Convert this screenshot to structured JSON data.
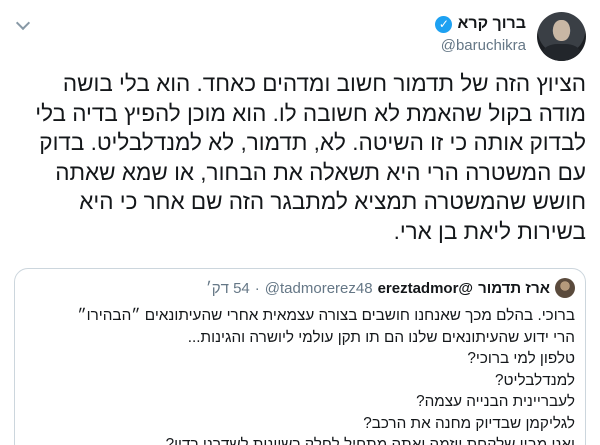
{
  "tweet": {
    "display_name": "ברוך קרא",
    "handle": "@baruchikra",
    "verified_icon": "verified-badge-icon",
    "text": "הציוץ הזה של תדמור חשוב ומדהים כאחד. הוא בלי בושה מודה בקול שהאמת לא חשובה לו. הוא מוכן להפיץ בדיה בלי לבדוק אותה כי זו השיטה. לא, תדמור, לא למנדלבליט. בדוק עם המשטרה הרי היא תשאלה את הבחור, או שמא שאתה חושש שהמשטרה תמציא למתבגר הזה שם אחר כי היא בשירות ליאת בן ארי."
  },
  "quote": {
    "display_name": "ארז תדמור",
    "handle": "ereztadmor@",
    "handle2": "@tadmorerez48",
    "separator": "·",
    "time": "54 דק׳",
    "lines": [
      "ברוכי. בהלם מכך שאנחנו חושבים בצורה עצמאית אחרי שהעיתונאים ״הבהירו״",
      "הרי ידוע שהעיתונאים שלנו הם תו תקן עולמי ליושרה והגינות...",
      "טלפון למי ברוכי?",
      "למנדלבליט?",
      "לעבריינית הבנייה עצמה?",
      "לגליקמן שבדיוק מחנה את הרכב?",
      "ואני מבין שלקחת יוזמה ואתה מתחיל לחלק רשיונות לשדרני רדיו?"
    ]
  }
}
